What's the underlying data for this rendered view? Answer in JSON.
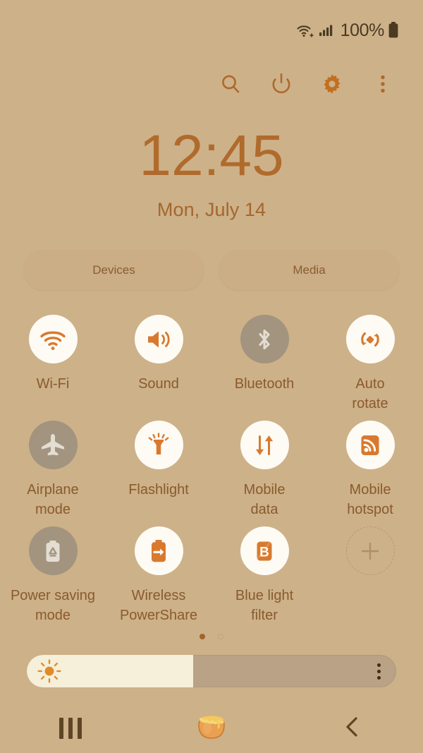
{
  "theme": {
    "background": "#cdb189",
    "accent": "#d9792e",
    "label_text": "#8a5a2e",
    "clock_text": "#b06b2c",
    "tile_on_bg": "#fdfbf4",
    "tile_off_bg": "#a2947f",
    "status_text": "#4a3a22"
  },
  "status_bar": {
    "wifi_icon": "wifi-plus-icon",
    "signal_icon": "cellular-signal-icon",
    "battery_percent": "100%",
    "battery_icon": "battery-full-icon"
  },
  "toolbar": {
    "items": [
      {
        "name": "search-icon",
        "label": "Search"
      },
      {
        "name": "power-icon",
        "label": "Power"
      },
      {
        "name": "gear-icon",
        "label": "Settings"
      },
      {
        "name": "overflow-menu-icon",
        "label": "More options"
      }
    ]
  },
  "clock": {
    "time": "12:45",
    "date": "Mon, July 14"
  },
  "pills": [
    {
      "label": "Devices",
      "name": "devices-button"
    },
    {
      "label": "Media",
      "name": "media-button"
    }
  ],
  "toggles": [
    {
      "label": "Wi-Fi",
      "icon": "wifi-icon",
      "state": "on"
    },
    {
      "label": "Sound",
      "icon": "sound-icon",
      "state": "on"
    },
    {
      "label": "Bluetooth",
      "icon": "bluetooth-icon",
      "state": "off"
    },
    {
      "label": "Auto\nrotate",
      "icon": "auto-rotate-icon",
      "state": "on"
    },
    {
      "label": "Airplane\nmode",
      "icon": "airplane-icon",
      "state": "off"
    },
    {
      "label": "Flashlight",
      "icon": "flashlight-icon",
      "state": "on"
    },
    {
      "label": "Mobile\ndata",
      "icon": "mobile-data-icon",
      "state": "on"
    },
    {
      "label": "Mobile\nhotspot",
      "icon": "mobile-hotspot-icon",
      "state": "on"
    },
    {
      "label": "Power saving\nmode",
      "icon": "power-saving-icon",
      "state": "off"
    },
    {
      "label": "Wireless\nPowerShare",
      "icon": "wireless-powershare-icon",
      "state": "on"
    },
    {
      "label": "Blue light\nfilter",
      "icon": "blue-light-filter-icon",
      "state": "on"
    },
    {
      "label": "",
      "icon": "add-tile-icon",
      "state": "add"
    }
  ],
  "page_dots": {
    "count": 2,
    "active_index": 0
  },
  "brightness": {
    "value_percent": 45,
    "sun_icon": "brightness-sun-icon",
    "menu_icon": "brightness-options-icon"
  },
  "nav_bar": {
    "recents": {
      "name": "recents-button",
      "icon": "recents-icon"
    },
    "home": {
      "name": "home-button",
      "icon": "honey-pot-icon"
    },
    "back": {
      "name": "back-button",
      "icon": "back-chevron-icon"
    }
  }
}
